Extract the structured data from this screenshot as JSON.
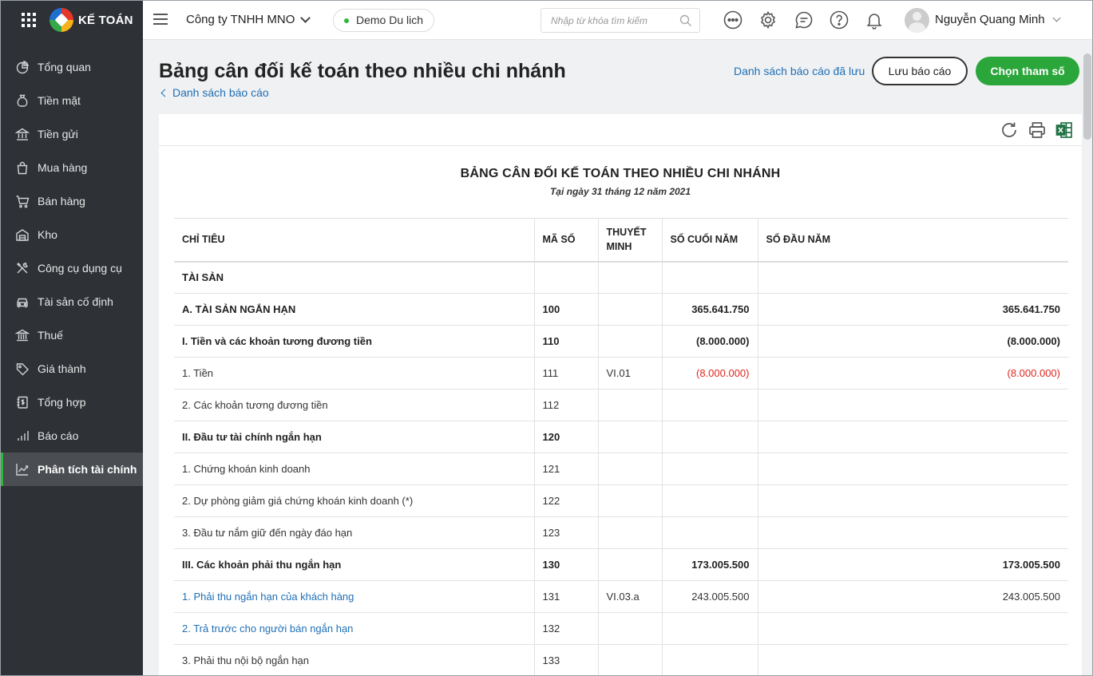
{
  "app": {
    "logo_text": "KẾ TOÁN",
    "company_name": "Công ty TNHH MNO",
    "demo_label": "Demo Du lich",
    "search_placeholder": "Nhập từ khóa tìm kiếm",
    "user_name": "Nguyễn Quang Minh"
  },
  "sidebar": {
    "items": [
      {
        "label": "Tổng quan",
        "icon": "dashboard-icon"
      },
      {
        "label": "Tiền mặt",
        "icon": "money-bag-icon"
      },
      {
        "label": "Tiền gửi",
        "icon": "bank-icon"
      },
      {
        "label": "Mua hàng",
        "icon": "shopping-bag-icon"
      },
      {
        "label": "Bán hàng",
        "icon": "cart-icon"
      },
      {
        "label": "Kho",
        "icon": "warehouse-icon"
      },
      {
        "label": "Công cụ dụng cụ",
        "icon": "tools-icon"
      },
      {
        "label": "Tài sản cố định",
        "icon": "car-icon"
      },
      {
        "label": "Thuế",
        "icon": "tax-building-icon"
      },
      {
        "label": "Giá thành",
        "icon": "price-tag-icon"
      },
      {
        "label": "Tổng hợp",
        "icon": "ledger-icon"
      },
      {
        "label": "Báo cáo",
        "icon": "bar-chart-icon"
      },
      {
        "label": "Phân tích tài chính",
        "icon": "line-chart-icon",
        "active": true
      }
    ]
  },
  "page": {
    "title": "Bảng cân đối kế toán theo nhiều chi nhánh",
    "back_link": "Danh sách báo cáo",
    "saved_reports_link": "Danh sách báo cáo đã lưu",
    "save_button": "Lưu báo cáo",
    "params_button": "Chọn tham số"
  },
  "report": {
    "heading": "BẢNG CÂN ĐỐI KẾ TOÁN THEO NHIỀU CHI NHÁNH",
    "subheading": "Tại ngày 31 tháng 12 năm 2021",
    "columns": [
      "CHỈ TIÊU",
      "MÃ SỐ",
      "THUYẾT MINH",
      "SỐ CUỐI NĂM",
      "SỐ ĐẦU NĂM"
    ],
    "rows": [
      {
        "name": "TÀI SẢN",
        "code": "",
        "note": "",
        "end": "",
        "begin": "",
        "bold": true
      },
      {
        "name": "A. TÀI SẢN NGẮN HẠN",
        "code": "100",
        "note": "",
        "end": "365.641.750",
        "begin": "365.641.750",
        "bold": true
      },
      {
        "name": "I. Tiền và các khoản tương đương tiền",
        "code": "110",
        "note": "",
        "end": "(8.000.000)",
        "begin": "(8.000.000)",
        "bold": true,
        "negative": true
      },
      {
        "name": "1. Tiền",
        "code": "111",
        "note": "VI.01",
        "end": "(8.000.000)",
        "begin": "(8.000.000)",
        "negative": true
      },
      {
        "name": "2. Các khoản tương đương tiền",
        "code": "112",
        "note": "",
        "end": "",
        "begin": ""
      },
      {
        "name": "II. Đầu tư tài chính ngắn hạn",
        "code": "120",
        "note": "",
        "end": "",
        "begin": "",
        "bold": true
      },
      {
        "name": "1. Chứng khoán kinh doanh",
        "code": "121",
        "note": "",
        "end": "",
        "begin": ""
      },
      {
        "name": "2. Dự phòng giảm giá chứng khoán kinh doanh (*)",
        "code": "122",
        "note": "",
        "end": "",
        "begin": ""
      },
      {
        "name": "3. Đầu tư nắm giữ đến ngày đáo hạn",
        "code": "123",
        "note": "",
        "end": "",
        "begin": ""
      },
      {
        "name": "III. Các khoản phải thu ngắn hạn",
        "code": "130",
        "note": "",
        "end": "173.005.500",
        "begin": "173.005.500",
        "bold": true
      },
      {
        "name": "1. Phải thu ngắn hạn của khách hàng",
        "code": "131",
        "note": "VI.03.a",
        "end": "243.005.500",
        "begin": "243.005.500",
        "link": true
      },
      {
        "name": "2. Trả trước cho người bán ngắn hạn",
        "code": "132",
        "note": "",
        "end": "",
        "begin": "",
        "link": true
      },
      {
        "name": "3. Phải thu nội bộ ngắn hạn",
        "code": "133",
        "note": "",
        "end": "",
        "begin": ""
      }
    ]
  },
  "colors": {
    "sidebar_bg": "#2e3136",
    "accent_green": "#2aa63a",
    "link_blue": "#1f6fb5",
    "negative_red": "#e0261f"
  }
}
